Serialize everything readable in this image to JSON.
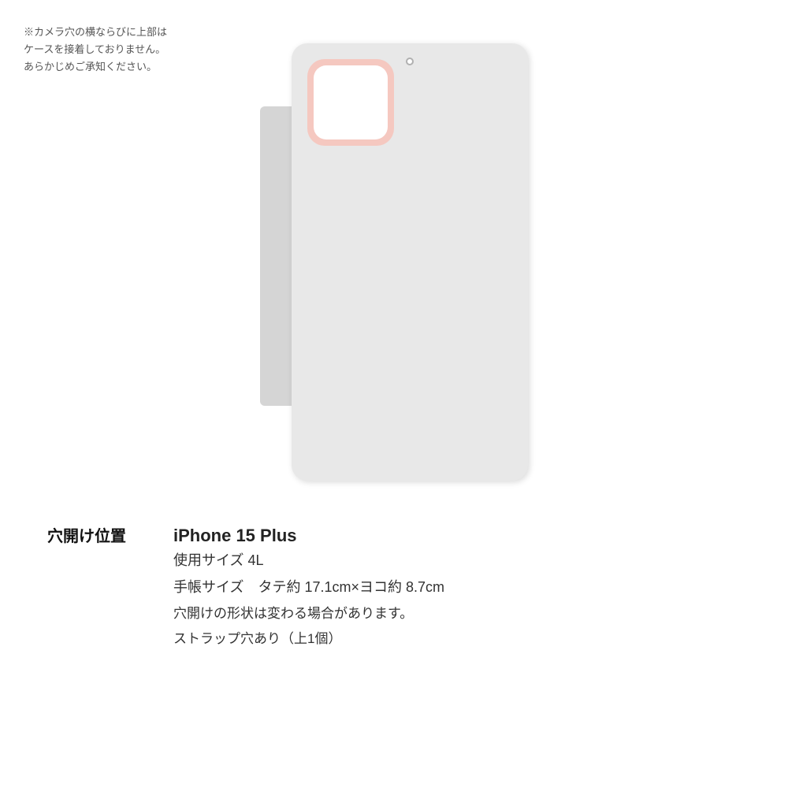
{
  "note": {
    "line1": "※カメラ穴の横ならびに上部は",
    "line2": "ケースを接着しておりません。",
    "line3": "あらかじめご承知ください。"
  },
  "hole_position_label": "穴開け位置",
  "specs": {
    "device": "iPhone 15 Plus",
    "size_label": "使用サイズ 4L",
    "notebook_size": "手帳サイズ　タテ約 17.1cm×ヨコ約 8.7cm",
    "hole_shape": "穴開けの形状は変わる場合があります。",
    "strap": "ストラップ穴あり（上1個）"
  }
}
